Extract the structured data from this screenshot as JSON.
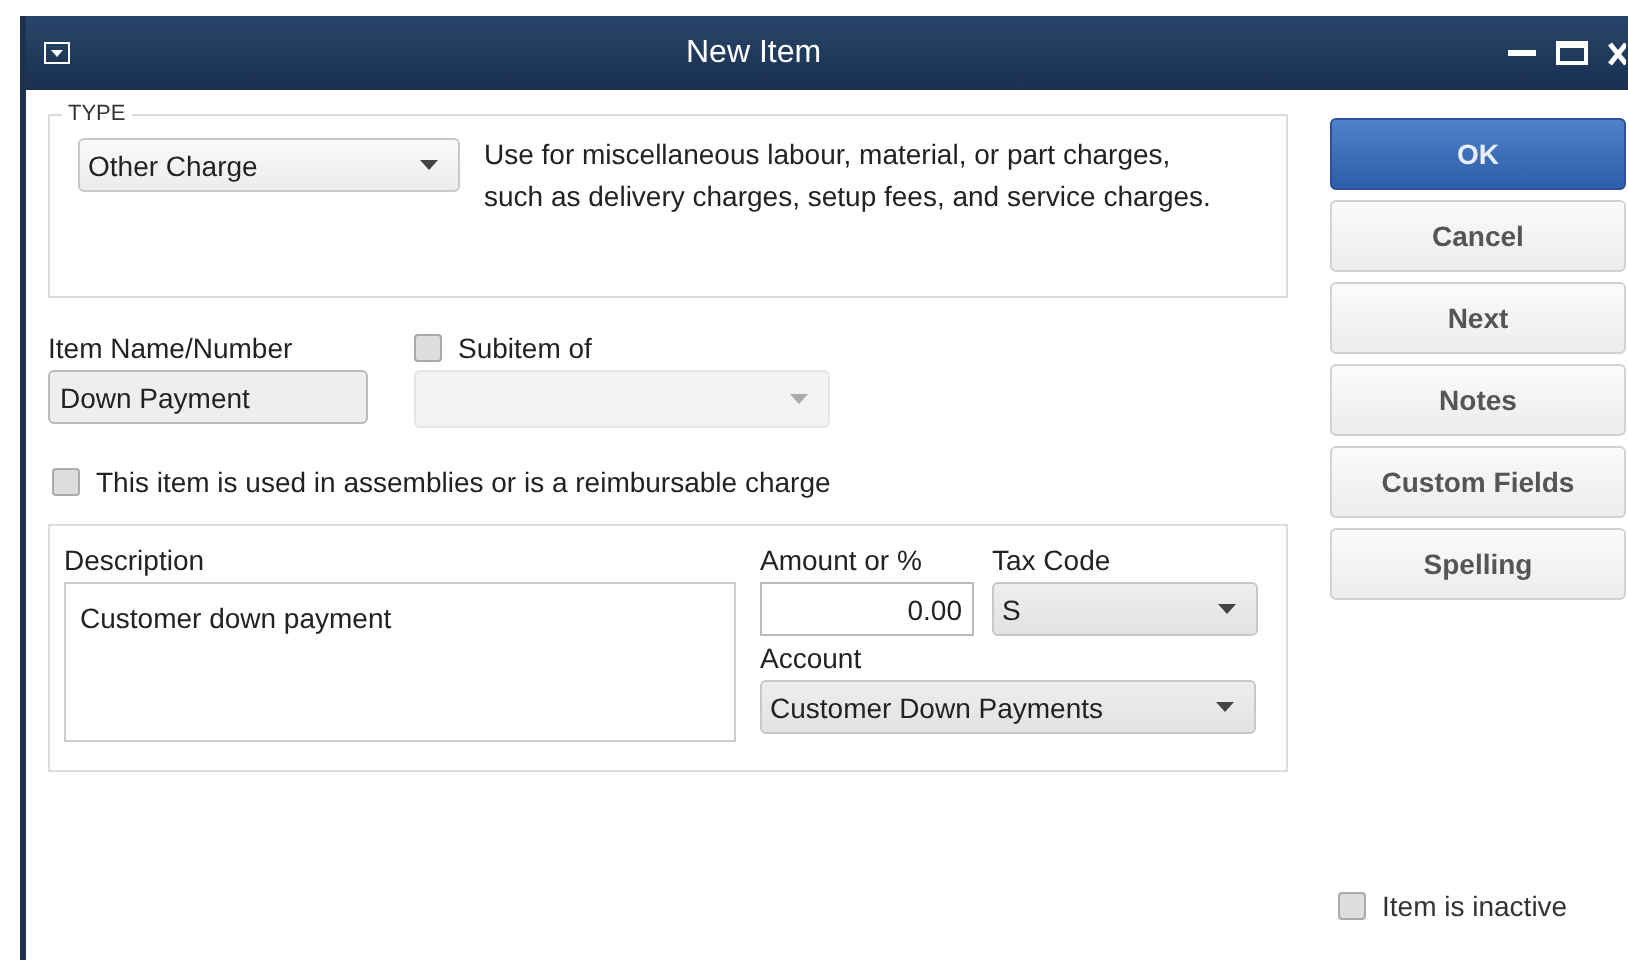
{
  "window": {
    "title": "New Item"
  },
  "type_section": {
    "legend": "TYPE",
    "type_value": "Other Charge",
    "description": "Use for miscellaneous labour, material, or part charges, such as delivery charges, setup fees, and service charges."
  },
  "item_name": {
    "label": "Item Name/Number",
    "value": "Down Payment"
  },
  "subitem": {
    "label": "Subitem of",
    "checked": false,
    "disabled": true
  },
  "assemblies_checkbox": {
    "label": "This item is used in assemblies or is a reimbursable charge",
    "checked": false
  },
  "details": {
    "description_label": "Description",
    "description": "Customer down payment",
    "amount_label": "Amount or %",
    "amount": "0.00",
    "tax_code_label": "Tax Code",
    "tax_code": "S",
    "account_label": "Account",
    "account": "Customer Down Payments"
  },
  "buttons": [
    {
      "label": "OK",
      "primary": true
    },
    {
      "label": "Cancel",
      "primary": false
    },
    {
      "label": "Next",
      "primary": false
    },
    {
      "label": "Notes",
      "primary": false
    },
    {
      "label": "Custom Fields",
      "primary": false
    },
    {
      "label": "Spelling",
      "primary": false
    }
  ],
  "inactive_checkbox": {
    "label": "Item is inactive",
    "checked": false
  }
}
